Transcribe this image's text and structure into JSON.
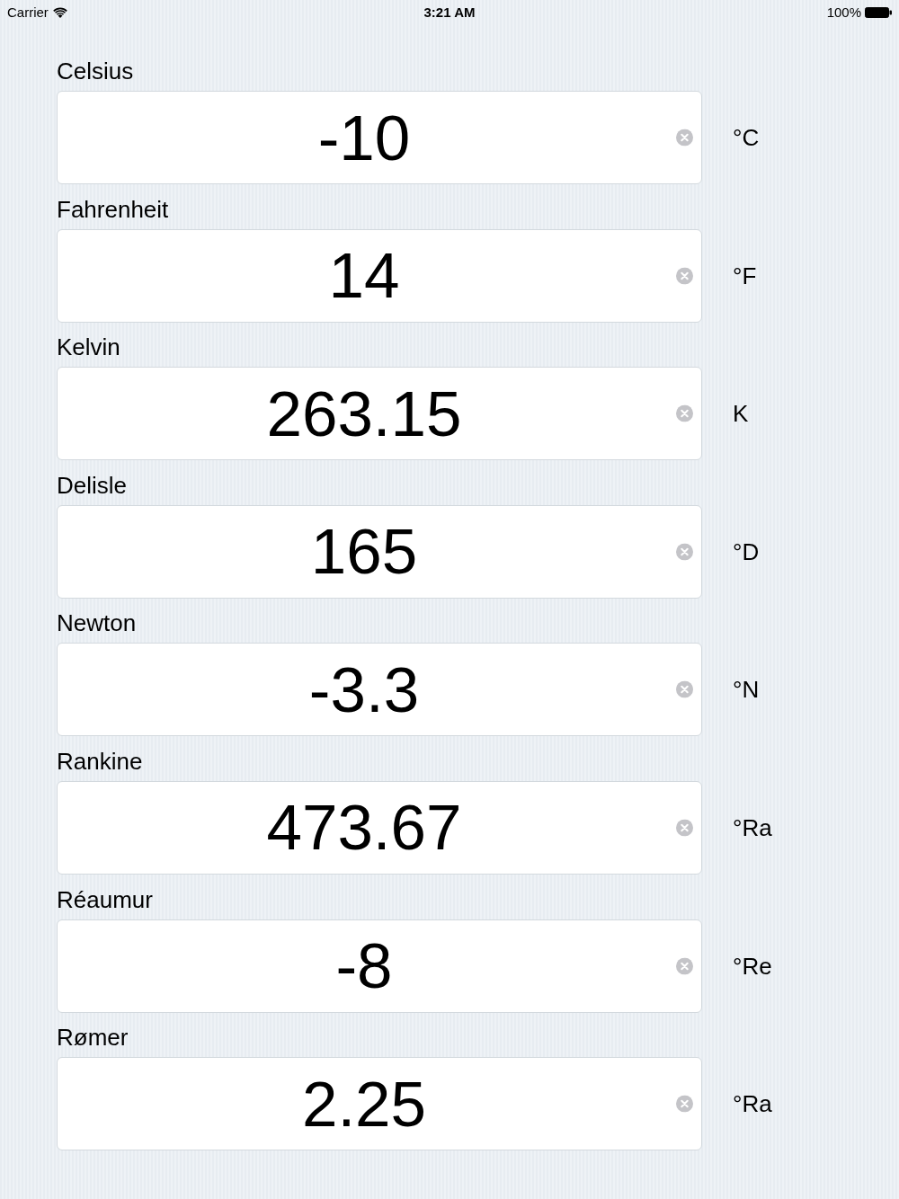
{
  "status_bar": {
    "carrier": "Carrier",
    "time": "3:21 AM",
    "battery": "100%"
  },
  "fields": [
    {
      "label": "Celsius",
      "value": "-10",
      "unit": "°C"
    },
    {
      "label": "Fahrenheit",
      "value": "14",
      "unit": "°F"
    },
    {
      "label": "Kelvin",
      "value": "263.15",
      "unit": "K"
    },
    {
      "label": "Delisle",
      "value": "165",
      "unit": "°D"
    },
    {
      "label": "Newton",
      "value": "-3.3",
      "unit": "°N"
    },
    {
      "label": "Rankine",
      "value": "473.67",
      "unit": "°Ra"
    },
    {
      "label": "Réaumur",
      "value": "-8",
      "unit": "°Re"
    },
    {
      "label": "Rømer",
      "value": "2.25",
      "unit": "°Ra"
    }
  ]
}
